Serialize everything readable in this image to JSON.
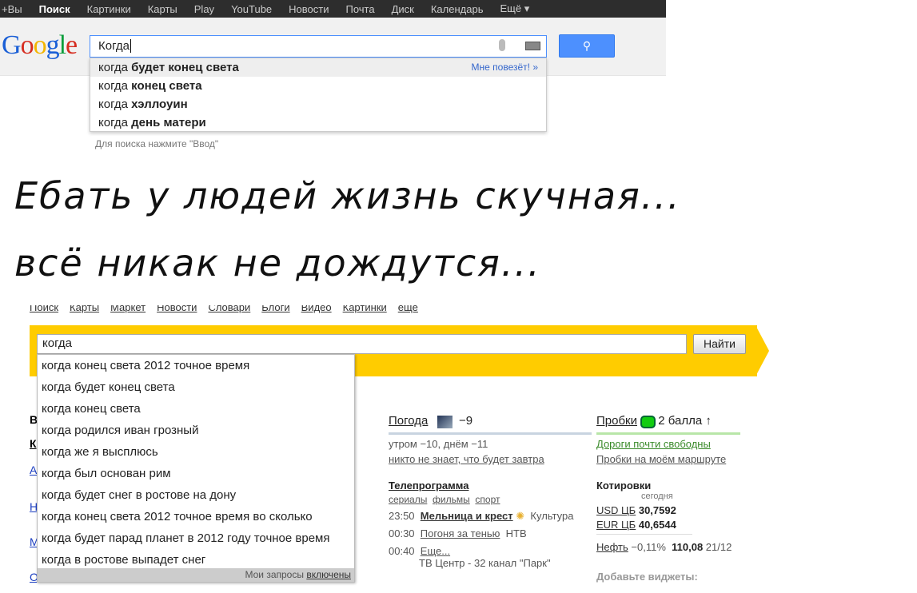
{
  "google": {
    "nav": [
      "+Вы",
      "Поиск",
      "Картинки",
      "Карты",
      "Play",
      "YouTube",
      "Новости",
      "Почта",
      "Диск",
      "Календарь",
      "Ещё ▾"
    ],
    "active_nav": "Поиск",
    "logo": "Google",
    "query": "Когда",
    "search_icon": "magnifier-icon",
    "suggestions": [
      {
        "prefix": "когда ",
        "bold": "будет конец света"
      },
      {
        "prefix": "когда ",
        "bold": "конец света"
      },
      {
        "prefix": "когда ",
        "bold": "хэллоуин"
      },
      {
        "prefix": "когда ",
        "bold": "день матери"
      }
    ],
    "lucky": "Мне повезёт! »",
    "hint": "Для поиска нажмите \"Ввод\""
  },
  "caption": {
    "line1": "Ебать у людей жизнь скучная...",
    "line2": "всё никак не дождутся..."
  },
  "yandex": {
    "accent": "#ffcc00",
    "query": "когда",
    "button": "Найти",
    "suggestions": [
      "когда конец света 2012 точное время",
      "когда будет конец света",
      "когда конец света",
      "когда родился иван грозный",
      "когда же я высплюсь",
      "когда был основан рим",
      "когда будет снег в ростове на дону",
      "когда конец света 2012 точное время во сколько",
      "когда будет парад планет в 2012 году точное время",
      "когда в ростове выпадет снег"
    ],
    "footer_text": "Мои запросы ",
    "footer_link": "включены",
    "weather": {
      "title": "Погода",
      "temp": "−9",
      "detail": "утром −10, днём −11",
      "link": "никто не знает, что будет завтра"
    },
    "tv": {
      "title": "Телепрограмма",
      "tabs": [
        "сериалы",
        "фильмы",
        "спорт"
      ],
      "items": [
        {
          "time": "23:50",
          "show": "Мельница и крест",
          "channel": "Культура"
        },
        {
          "time": "00:30",
          "show": "Погоня за тенью",
          "channel": "НТВ"
        },
        {
          "time": "00:40",
          "show": "Еще...",
          "channel": "ТВ Центр - 32 канал \"Парк\""
        }
      ]
    },
    "traffic": {
      "title": "Пробки",
      "score": "2 балла ↑",
      "status": "Дороги почти свободны",
      "route": "Пробки на моём маршруте"
    },
    "quotes": {
      "title": "Котировки",
      "col": "сегодня",
      "rows": [
        {
          "name": "USD ЦБ",
          "value": "30,7592"
        },
        {
          "name": "EUR ЦБ",
          "value": "40,6544"
        }
      ],
      "oil": {
        "name": "Нефть",
        "change": "−0,11%",
        "value": "110,08",
        "date": "21/12"
      }
    },
    "widgets": "Добавьте виджеты:"
  }
}
